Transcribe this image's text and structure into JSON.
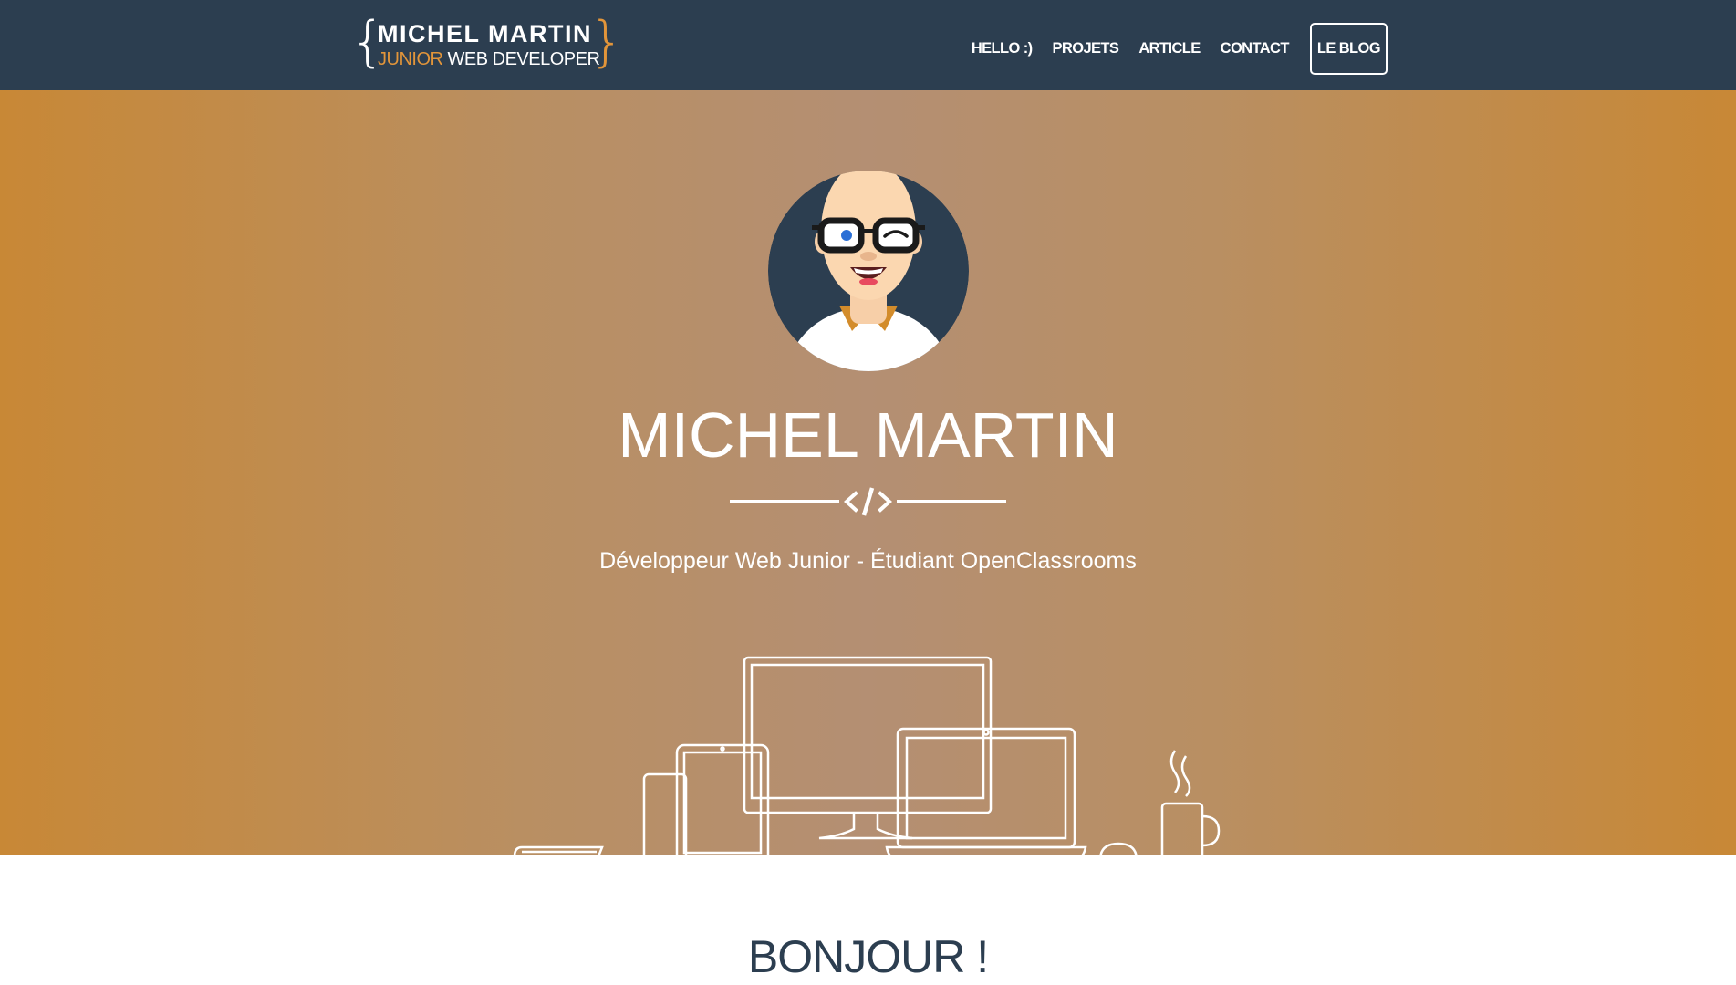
{
  "brand": {
    "name": "MICHEL MARTIN",
    "sub_accent": "JUNIOR",
    "sub_rest": " WEB DEVELOPER",
    "brace_left": "{",
    "brace_right": "}"
  },
  "nav": {
    "items": [
      {
        "label": "HELLO :)"
      },
      {
        "label": "PROJETS"
      },
      {
        "label": "ARTICLE"
      },
      {
        "label": "CONTACT"
      }
    ],
    "blog_label": "LE BLOG"
  },
  "hero": {
    "title": "MICHEL MARTIN",
    "subtitle": "Développeur Web Junior - Étudiant OpenClassrooms",
    "divider_icon": "code-icon"
  },
  "about": {
    "title": "BONJOUR !"
  },
  "colors": {
    "navbar": "#2c3e50",
    "accent": "#e2953a",
    "hero_edge": "#c88836",
    "hero_center": "#b48f73",
    "heading": "#2c3e50"
  }
}
